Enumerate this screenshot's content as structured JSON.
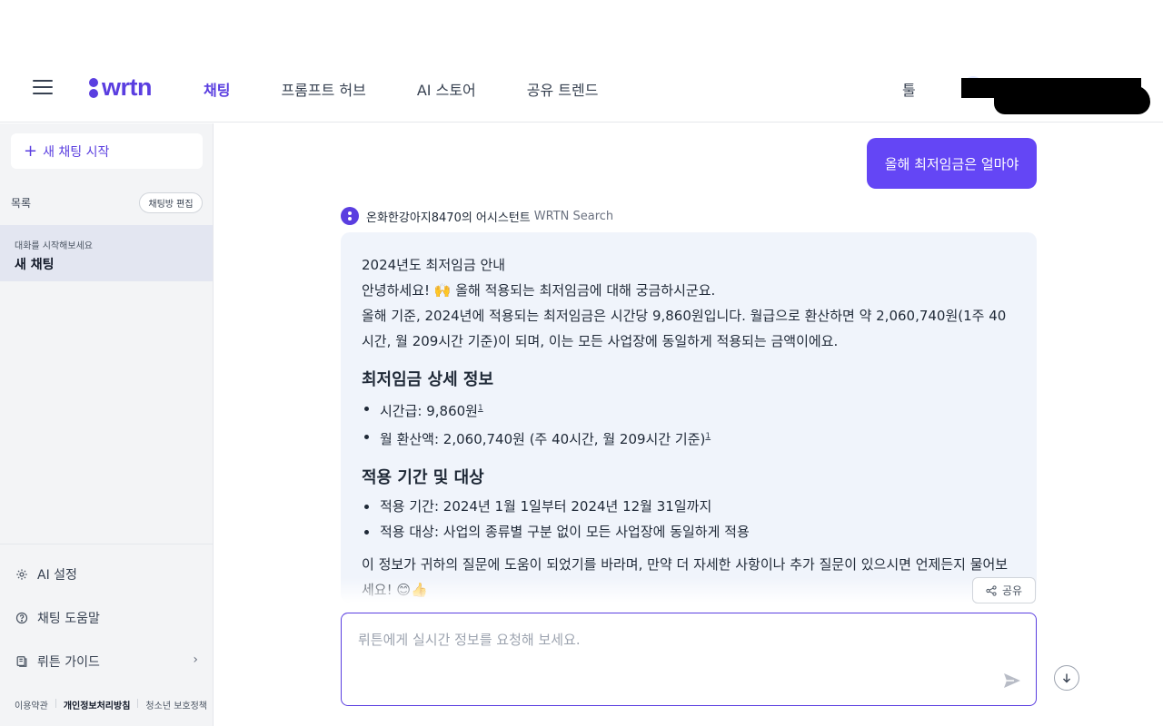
{
  "header": {
    "logo_text": "wrtn",
    "nav": [
      {
        "label": "채팅",
        "active": true
      },
      {
        "label": "프롬프트 허브",
        "active": false
      },
      {
        "label": "AI 스토어",
        "active": false
      },
      {
        "label": "공유 트렌드",
        "active": false
      }
    ],
    "tools_label": "툴",
    "accent_color": "#5a3ee0"
  },
  "sidebar": {
    "new_chat_label": "새 채팅 시작",
    "list_label": "목록",
    "edit_label": "채팅방 편집",
    "chat_item": {
      "subtitle": "대화를 시작해보세요",
      "title": "새 채팅"
    },
    "links": [
      {
        "icon": "gear-icon",
        "label": "AI 설정"
      },
      {
        "icon": "help-circle-icon",
        "label": "채팅 도움말"
      },
      {
        "icon": "book-icon",
        "label": "뤼튼 가이드"
      }
    ],
    "footer": [
      "이용약관",
      "개인정보처리방침",
      "청소년 보호정책"
    ]
  },
  "chat": {
    "user_message": "올해 최저임금은 얼마야",
    "assistant_name": "온화한강아지8470의 어시스턴트",
    "assistant_tag": "WRTN Search",
    "answer": {
      "heading": "2024년도 최저임금 안내",
      "greeting": "안녕하세요! 🙌 올해 적용되는 최저임금에 대해 궁금하시군요.",
      "intro": "올해 기준, 2024년에 적용되는 최저임금은 시간당 9,860원입니다. 월급으로 환산하면 약 2,060,740원(1주 40시간, 월 209시간 기준)이 되며, 이는 모든 사업장에 동일하게 적용되는 금액이에요.",
      "section1_title": "최저임금 상세 정보",
      "section1_items": [
        {
          "text": "시간급: 9,860원",
          "ref": "1"
        },
        {
          "text": "월 환산액: 2,060,740원 (주 40시간, 월 209시간 기준)",
          "ref": "1"
        }
      ],
      "section2_title": "적용 기간 및 대상",
      "section2_items": [
        {
          "text": "적용 기간: 2024년 1월 1일부터 2024년 12월 31일까지"
        },
        {
          "text": "적용 대상: 사업의 종류별 구분 없이 모든 사업장에 동일하게 적용"
        }
      ],
      "closing": "이 정보가 귀하의 질문에 도움이 되었기를 바라며, 만약 더 자세한 사항이나 추가 질문이 있으시면 언제든지 물어보세요! 😊👍"
    },
    "share_label": "공유",
    "input_placeholder": "뤼튼에게 실시간 정보를 요청해 보세요."
  }
}
